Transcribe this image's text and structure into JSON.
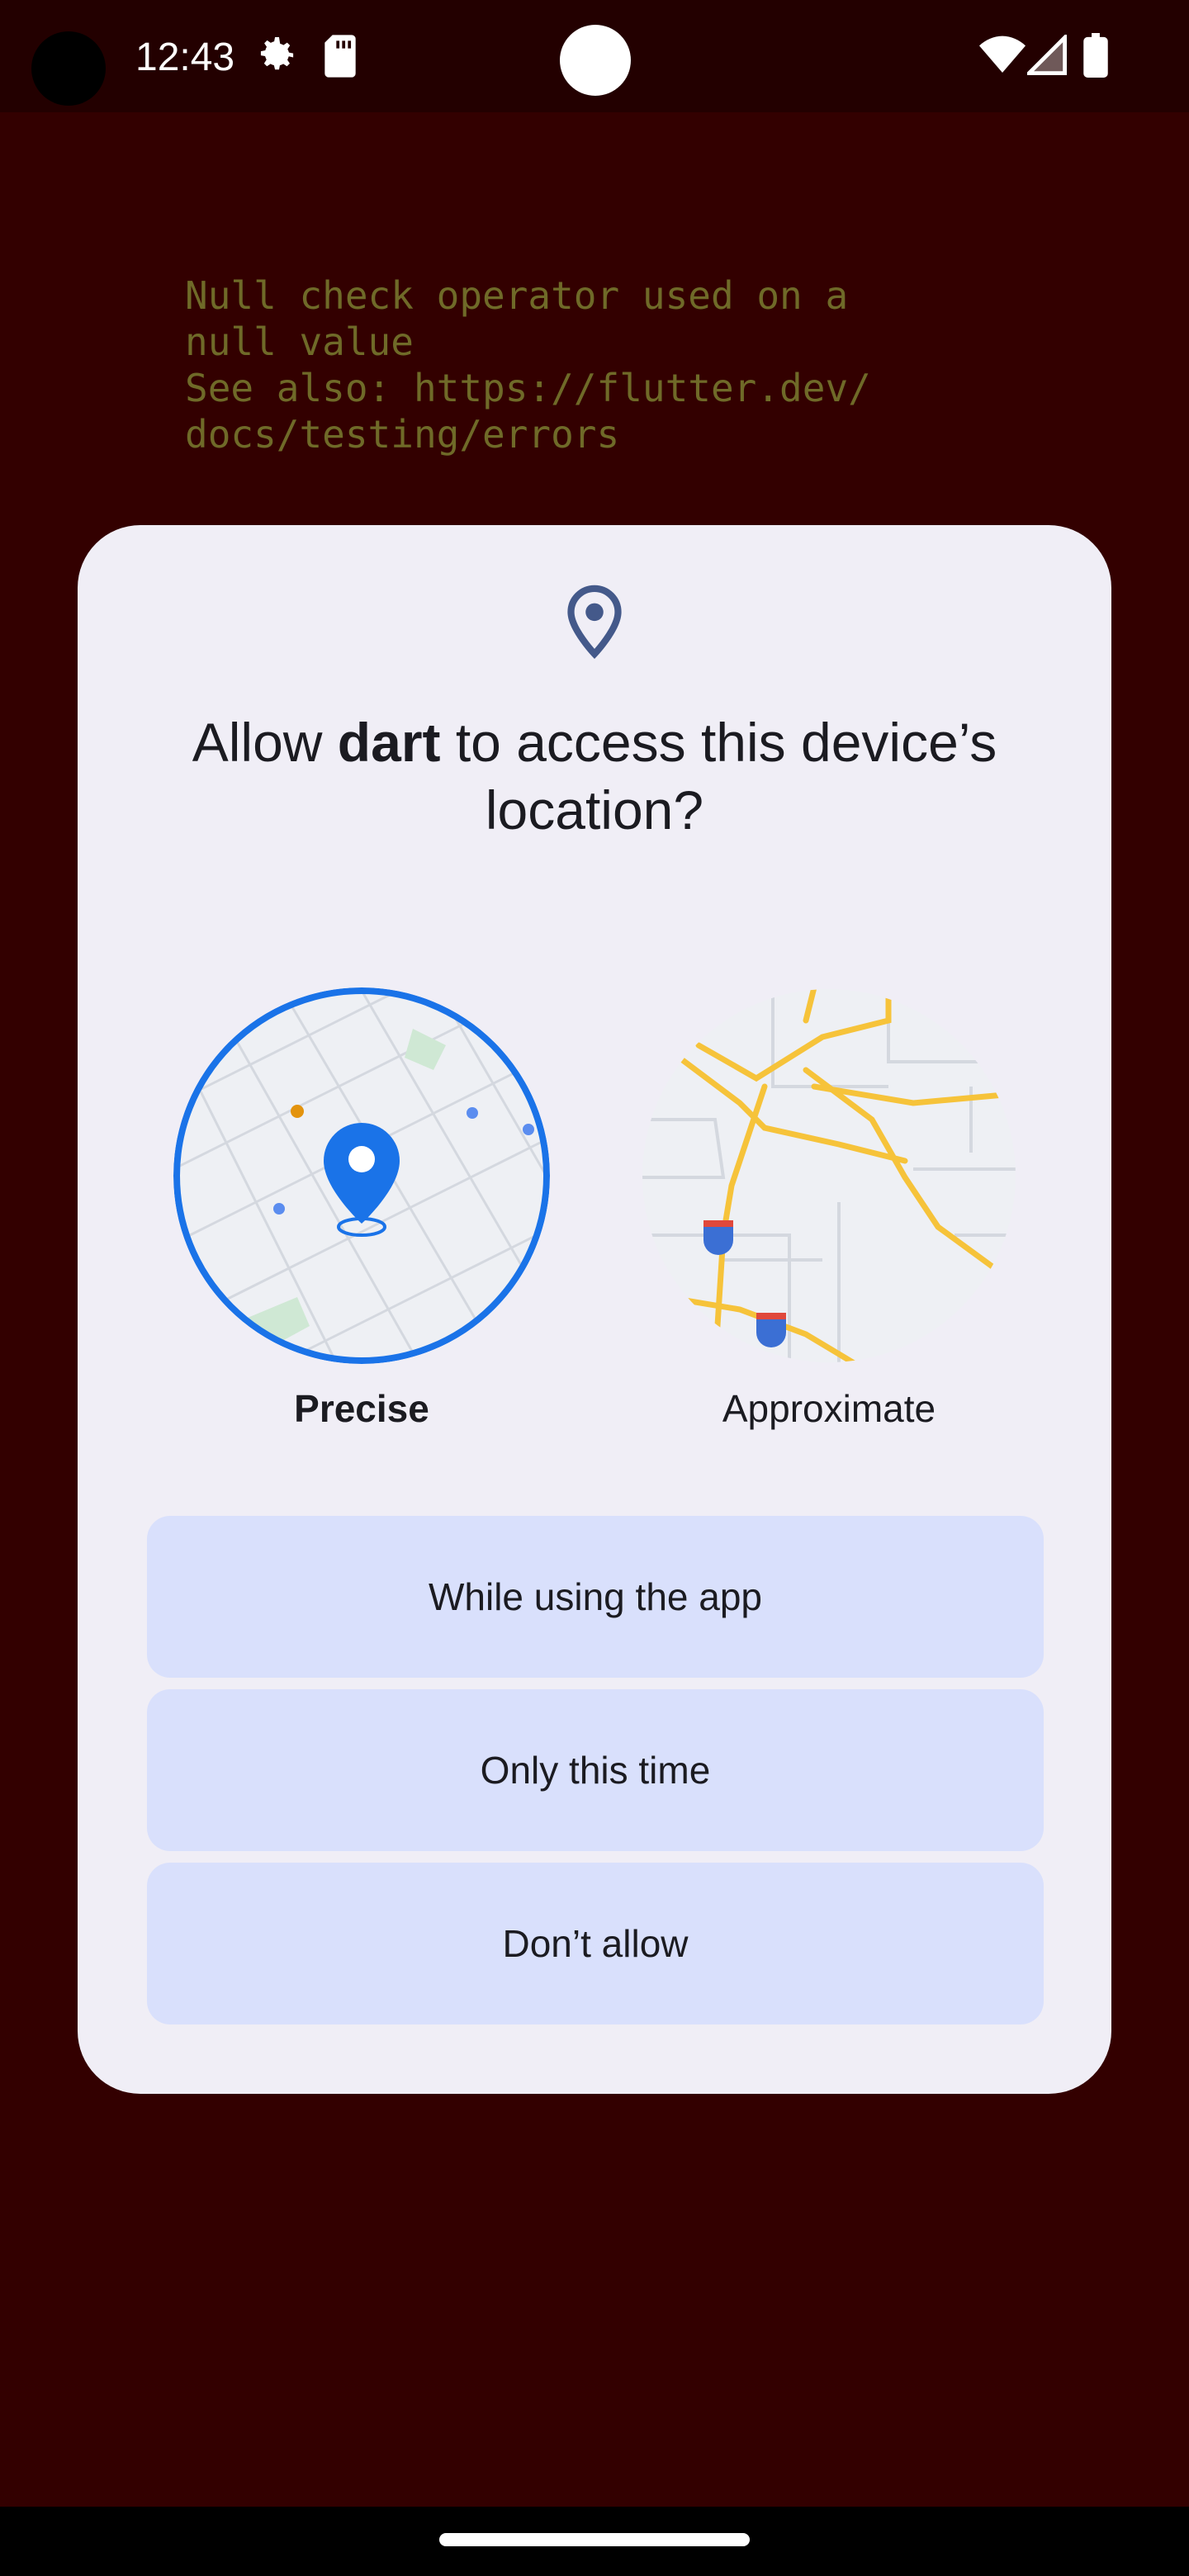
{
  "status_bar": {
    "time": "12:43",
    "icons": [
      "settings-gear-icon",
      "sd-card-icon",
      "wifi-icon",
      "signal-icon",
      "battery-icon"
    ]
  },
  "error": {
    "message": "Null check operator used on a\nnull value\nSee also: https://flutter.dev/\ndocs/testing/errors"
  },
  "dialog": {
    "icon": "location-pin-icon",
    "title_prefix": "Allow ",
    "title_app": "dart",
    "title_suffix": " to access this device’s location?",
    "options": {
      "precise_label": "Precise",
      "approximate_label": "Approximate",
      "selected": "Precise"
    },
    "buttons": {
      "while_using": "While using the app",
      "only_this_time": "Only this time",
      "dont_allow": "Don’t allow"
    }
  },
  "colors": {
    "background": "#330000",
    "status_bar": "#230000",
    "dialog_bg": "#f0eef6",
    "button_bg": "#d9e0fc",
    "accent_blue": "#1a73e8",
    "error_text": "#6f6a28",
    "road_yellow": "#f6c33a"
  }
}
